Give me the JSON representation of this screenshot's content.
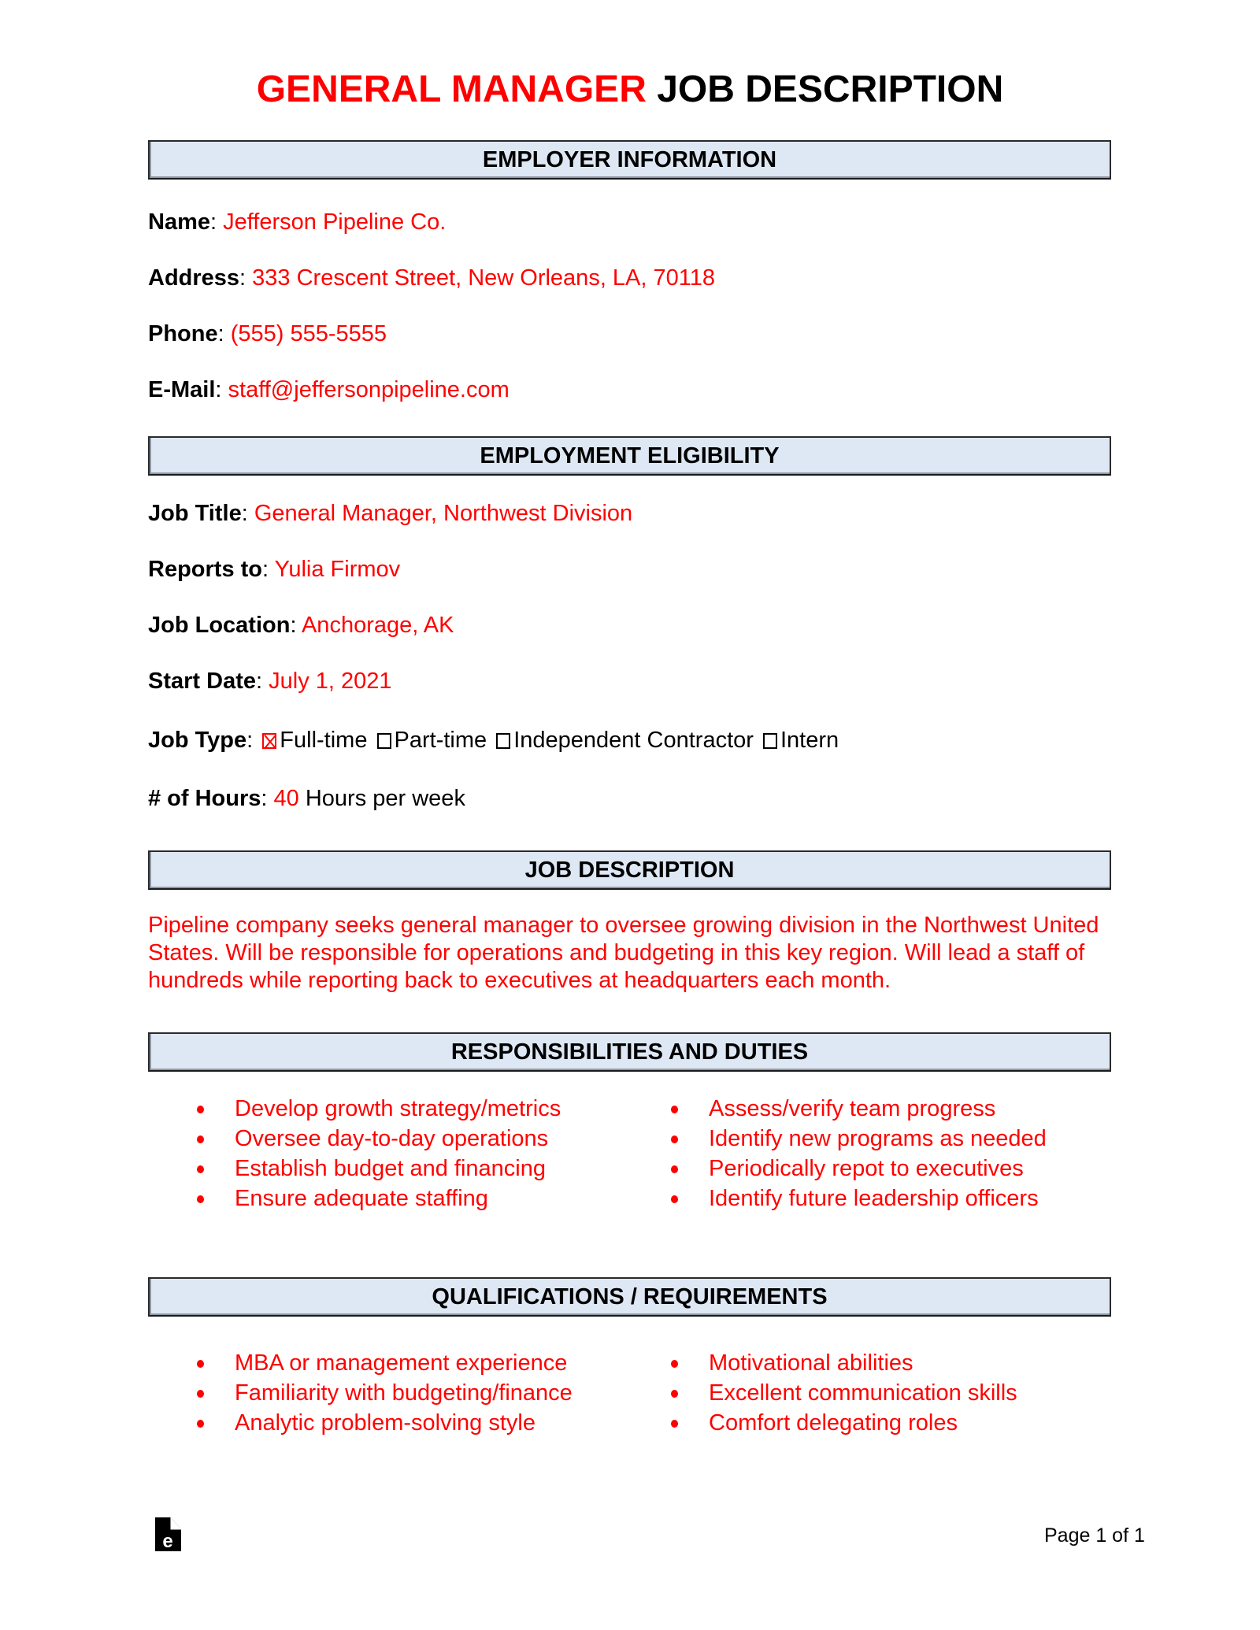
{
  "document": {
    "title_accent": "GENERAL MANAGER",
    "title_rest": " JOB DESCRIPTION",
    "colors": {
      "accent": "#ff0000",
      "section_bar": "#dee8f4",
      "text": "#000000"
    }
  },
  "employer": {
    "section_title": "EMPLOYER INFORMATION",
    "name_label": "Name",
    "name_value": "Jefferson Pipeline Co.",
    "address_label": "Address",
    "address_value": "333 Crescent Street, New Orleans, LA, 70118",
    "phone_label": "Phone",
    "phone_value": "(555) 555-5555",
    "email_label": "E-Mail",
    "email_value": "staff@jeffersonpipeline.com"
  },
  "eligibility": {
    "section_title": "EMPLOYMENT ELIGIBILITY",
    "job_title_label": "Job Title",
    "job_title_value": "General Manager, Northwest Division",
    "reports_to_label": "Reports to",
    "reports_to_value": "Yulia Firmov",
    "location_label": "Job Location",
    "location_value": "Anchorage, AK",
    "start_date_label": "Start Date",
    "start_date_value": "July 1, 2021",
    "job_type_label": "Job Type",
    "job_type_options": [
      {
        "label": "Full-time",
        "checked": true
      },
      {
        "label": "Part-time",
        "checked": false
      },
      {
        "label": "Independent Contractor",
        "checked": false
      },
      {
        "label": "Intern",
        "checked": false
      }
    ],
    "hours_label": "# of Hours",
    "hours_value": "40",
    "hours_suffix": " Hours per week"
  },
  "job_description": {
    "section_title": "JOB DESCRIPTION",
    "text": "Pipeline company seeks general manager to oversee growing division in the Northwest United States. Will be responsible for operations and budgeting in this key region. Will lead a staff of hundreds while reporting back to executives at headquarters each month."
  },
  "responsibilities": {
    "section_title": "RESPONSIBILITIES AND DUTIES",
    "left": [
      "Develop growth strategy/metrics",
      "Oversee day-to-day operations",
      "Establish budget and financing",
      "Ensure adequate staffing"
    ],
    "right": [
      "Assess/verify team progress",
      "Identify new programs as needed",
      "Periodically repot to executives",
      "Identify future leadership officers"
    ]
  },
  "qualifications": {
    "section_title": "QUALIFICATIONS / REQUIREMENTS",
    "left": [
      "MBA or management experience",
      "Familiarity with budgeting/finance",
      "Analytic problem-solving style"
    ],
    "right": [
      "Motivational abilities",
      "Excellent communication skills",
      "Comfort delegating roles"
    ]
  },
  "footer": {
    "logo_icon": "eforms-logo-icon",
    "page_label": "Page 1 of 1"
  }
}
